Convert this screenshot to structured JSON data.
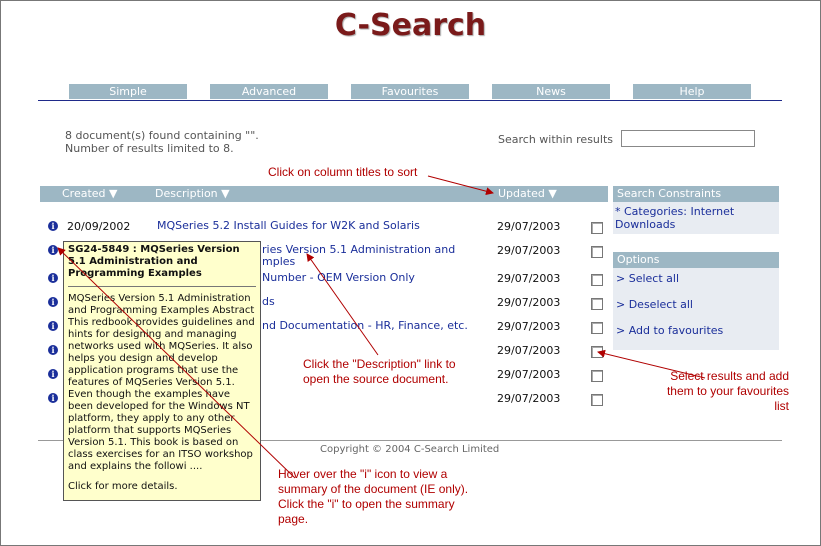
{
  "app": {
    "logo": "C-Search"
  },
  "nav": {
    "tabs": [
      {
        "label": "Simple"
      },
      {
        "label": "Advanced"
      },
      {
        "label": "Favourites"
      },
      {
        "label": "News"
      },
      {
        "label": "Help"
      }
    ]
  },
  "results_info": {
    "line1": "8 document(s) found containing \"\".",
    "line2": "Number of results limited to 8."
  },
  "search_within": {
    "label": "Search within results",
    "value": ""
  },
  "table": {
    "headers": {
      "created": "Created ▼",
      "description": "Description ▼",
      "updated": "Updated ▼"
    },
    "rows": [
      {
        "created": "20/09/2002",
        "description": "MQSeries 5.2 Install Guides for W2K and Solaris",
        "updated": "29/07/2003"
      },
      {
        "created": "",
        "description": "ries Version 5.1 Administration and",
        "description2": "mples",
        "updated": "29/07/2003"
      },
      {
        "created": "",
        "description": "Number - OEM Version Only",
        "updated": "29/07/2003"
      },
      {
        "created": "",
        "description": "ds",
        "updated": "29/07/2003"
      },
      {
        "created": "",
        "description": "nd Documentation - HR, Finance, etc.",
        "updated": "29/07/2003"
      },
      {
        "created": "",
        "description": "",
        "updated": "29/07/2003"
      },
      {
        "created": "",
        "description": "",
        "updated": "29/07/2003"
      },
      {
        "created": "",
        "description": "",
        "updated": "29/07/2003"
      }
    ]
  },
  "search_constraints": {
    "title": "Search Constraints",
    "body": "* Categories: Internet Downloads"
  },
  "options": {
    "title": "Options",
    "items": [
      "> Select all",
      "> Deselect all",
      "> Add to favourites"
    ]
  },
  "footer": {
    "copyright": "Copyright © 2004 C-Search Limited"
  },
  "tooltip": {
    "title": "SG24-5849 : MQSeries Version 5.1 Administration and Programming Examples",
    "body": "MQSeries Version 5.1 Administration and Programming Examples Abstract This redbook provides guidelines and hints for designing and managing networks used with MQSeries. It also helps you design and develop application programs that use the features of MQSeries Version 5.1. Even though the examples have been developed for the Windows NT platform, they apply to any other platform that supports MQSeries Version 5.1. This book is based on class exercises for an ITSO workshop and explains the followi ....",
    "more": "Click for more details."
  },
  "annotations": {
    "sort": "Click on column titles to sort",
    "description_link": "Click the \"Description\" link to open the source document.",
    "favourites": "Select results and add them to your favourites list",
    "info_icon": "Hover over the \"i\" icon to view a summary of the document (IE only). Click the \"i\" to open the summary page."
  },
  "colors": {
    "accent": "#9db7c4",
    "link": "#1a2e9a",
    "annotation": "#b00000",
    "logo": "#7a1a1a"
  }
}
